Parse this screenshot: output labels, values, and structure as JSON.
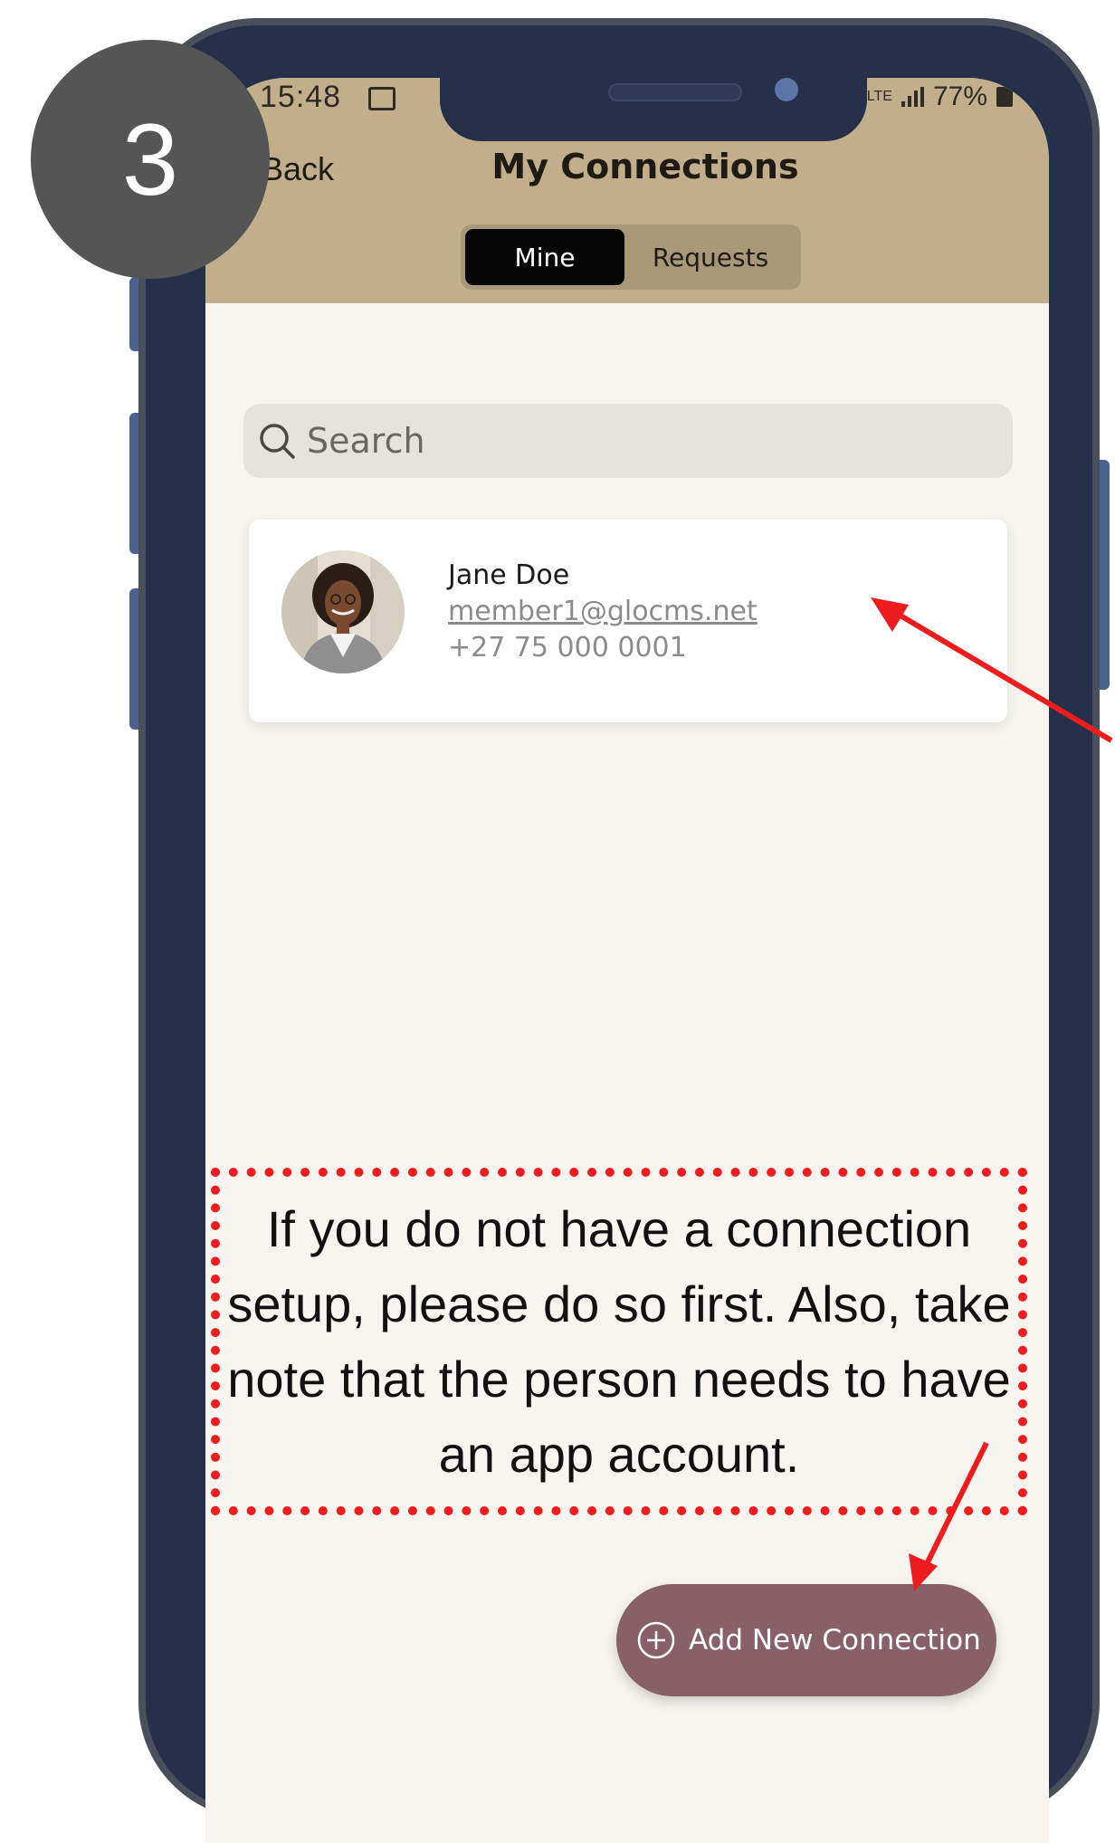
{
  "step": {
    "number": "3"
  },
  "status_bar": {
    "time": "15:48",
    "network": "LTE",
    "battery": "77%"
  },
  "header": {
    "back_label": "Back",
    "title": "My Connections",
    "tabs": [
      {
        "label": "Mine",
        "active": true
      },
      {
        "label": "Requests",
        "active": false
      }
    ]
  },
  "search": {
    "placeholder": "Search"
  },
  "connections": [
    {
      "name": "Jane Doe",
      "email": "member1@glocms.net",
      "phone": "+27 75 000 0001"
    }
  ],
  "add_button": {
    "label": "Add New Connection"
  },
  "note": {
    "text": "If you do not have a connection setup, please do so first. Also, take note that the person needs to have an app account."
  },
  "colors": {
    "header_bg": "#c2ae8a",
    "screen_bg": "#f8f5f1",
    "phone_frame": "#26304a",
    "active_tab": "#050505",
    "add_button": "#886168",
    "annotation_red": "#ee1c1c",
    "step_badge": "#555555"
  }
}
